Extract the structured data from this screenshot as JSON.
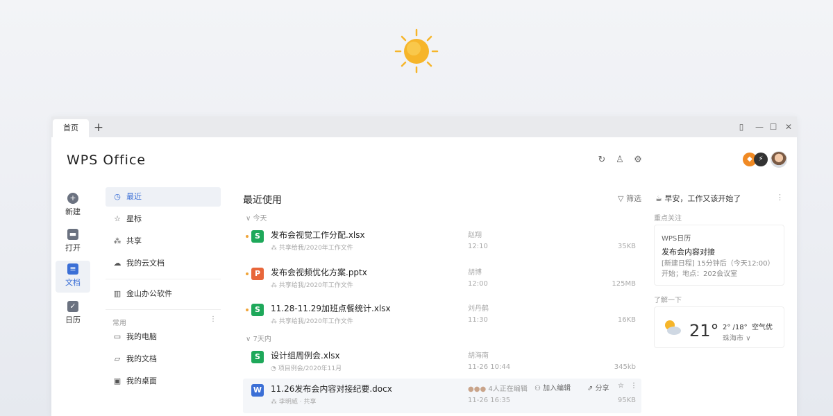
{
  "tabs": {
    "home": "首页",
    "add": "+"
  },
  "window_controls": [
    "restore-icon",
    "minimize-icon",
    "maximize-icon",
    "close-icon"
  ],
  "header": {
    "logo": "WPS Office",
    "icons": [
      "sync-icon",
      "skin-icon",
      "settings-icon"
    ]
  },
  "rail": [
    {
      "label": "新建",
      "icon": "plus-icon"
    },
    {
      "label": "打开",
      "icon": "folder-icon"
    },
    {
      "label": "文档",
      "icon": "document-icon",
      "active": true
    },
    {
      "label": "日历",
      "icon": "calendar-icon"
    }
  ],
  "nav": {
    "items": [
      {
        "label": "最近",
        "icon": "clock-icon",
        "active": true
      },
      {
        "label": "星标",
        "icon": "star-icon"
      },
      {
        "label": "共享",
        "icon": "share-icon"
      },
      {
        "label": "我的云文档",
        "icon": "cloud-icon"
      }
    ],
    "app": {
      "label": "金山办公软件",
      "icon": "building-icon"
    },
    "common_label": "常用",
    "common": [
      {
        "label": "我的电脑",
        "icon": "monitor-icon"
      },
      {
        "label": "我的文档",
        "icon": "folder-icon"
      },
      {
        "label": "我的桌面",
        "icon": "desktop-icon"
      }
    ]
  },
  "main": {
    "title": "最近使用",
    "filter": "筛选",
    "groups": {
      "today": "今天",
      "week": "7天内"
    },
    "files": [
      {
        "name": "发布会视觉工作分配.xlsx",
        "path": "共享给我/2020年工作文件",
        "user": "赵翔",
        "date": "12:10",
        "size": "35KB",
        "type": "S",
        "color": "#1ea85a"
      },
      {
        "name": "发布会视频优化方案.pptx",
        "path": "共享给我/2020年工作文件",
        "user": "胡博",
        "date": "12:00",
        "size": "125MB",
        "type": "P",
        "color": "#e8663a"
      },
      {
        "name": "11.28-11.29加班点餐统计.xlsx",
        "path": "共享给我/2020年工作文件",
        "user": "刘丹鹤",
        "date": "11:30",
        "size": "16KB",
        "type": "S",
        "color": "#1ea85a"
      },
      {
        "name": "设计组周例会.xlsx",
        "path": "项目例会/2020年11月",
        "user": "胡海南",
        "date": "11-26 10:44",
        "size": "345kb",
        "type": "S",
        "color": "#1ea85a"
      },
      {
        "name": "11.26发布会内容对接纪要.docx",
        "path": "李明威 · 共享",
        "editing": "4人正在编辑",
        "add_edit": "加入编辑",
        "share": "分享",
        "date": "11-26 16:35",
        "size": "95KB",
        "type": "W",
        "color": "#3b6fd6"
      }
    ]
  },
  "right": {
    "greeting": "早安，工作又该开始了",
    "focus_label": "重点关注",
    "calendar": {
      "title": "WPS日历",
      "event": "发布会内容对接",
      "detail": "[新建日程] 15分钟后（今天12:00）开始；地点：202会议室"
    },
    "know_label": "了解一下",
    "weather": {
      "temp": "21°",
      "range": "2° /18°",
      "air": "空气优",
      "city": "珠海市"
    }
  },
  "colors": {
    "accent": "#3b6fd6",
    "dot": "#f0a53a",
    "sun": "#f6b52a"
  }
}
